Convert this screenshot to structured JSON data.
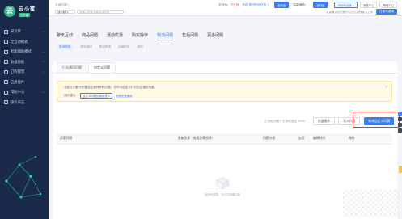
{
  "app": {
    "name": "云小蜜",
    "badge": "已开通"
  },
  "sidebar": {
    "items": [
      {
        "label": "知识库",
        "icon": "book-icon",
        "chevron": "^"
      },
      {
        "label": "全自动模式",
        "icon": "robot-icon",
        "chevron": ""
      },
      {
        "label": "智能辅助模式",
        "icon": "assist-icon",
        "chevron": "^"
      },
      {
        "label": "数据看板",
        "icon": "chart-icon",
        "chevron": "^"
      },
      {
        "label": "订购管理",
        "icon": "cart-icon",
        "chevron": "^"
      },
      {
        "label": "应用插件",
        "icon": "plugin-icon",
        "chevron": ""
      },
      {
        "label": "帮助中心",
        "icon": "help-icon",
        "chevron": "^"
      },
      {
        "label": "操作日志",
        "icon": "log-icon",
        "chevron": ""
      }
    ]
  },
  "topbar": {
    "breadcrumb": "店铺机器人",
    "status_prefix": "全自动：",
    "status_value": "已开启",
    "status_link": "开启  如何开启状态 >",
    "mode_btn": "去开启",
    "assist_label": "智能辅助：",
    "assist_btn": "去开启",
    "shop_select": "请切换店铺 ∨",
    "version_btn": "消息中心",
    "help_btn": "帮助中心",
    "filter_select": "请问题 ∨",
    "search_placeholder": "请输入搜索关键词或问题",
    "hint": "如需要添加问题可以在后台按要求上传",
    "buy_btn": "订阅与咨询"
  },
  "tabs": [
    "聊天互动",
    "商品问题",
    "活动优惠",
    "购买操作",
    "物流问题",
    "售后问题",
    "更多问题"
  ],
  "active_tab": 4,
  "subtabs": [
    "查询物流",
    "物流选择",
    "物流异常",
    "运输时效",
    "其他"
  ],
  "card": {
    "tabs": [
      "行业通用问题",
      "自定义问题"
    ],
    "notice_line1": "· 自定义问题可配置您店铺特有的问题，也可以自定义针对您店铺的场景。",
    "notice_prefix": "· 操作建议：",
    "notice_tag": "自定义问题配置教程 ∨",
    "notice_link": "查看完整使用",
    "notice_close": "×",
    "count_prefix": "已添加问题",
    "count_value": "0",
    "count_suffix": "  已添加回答 0/100",
    "btn_batch": "批量操作",
    "btn_import": "导入问题",
    "btn_new": "新增自定义问题",
    "columns": [
      "买家问题",
      "答复答案（查看答案规则）",
      "问题分组",
      "启用",
      "编辑时间",
      "操作"
    ],
    "empty_text": "还未有数据，可点击新增问题"
  }
}
